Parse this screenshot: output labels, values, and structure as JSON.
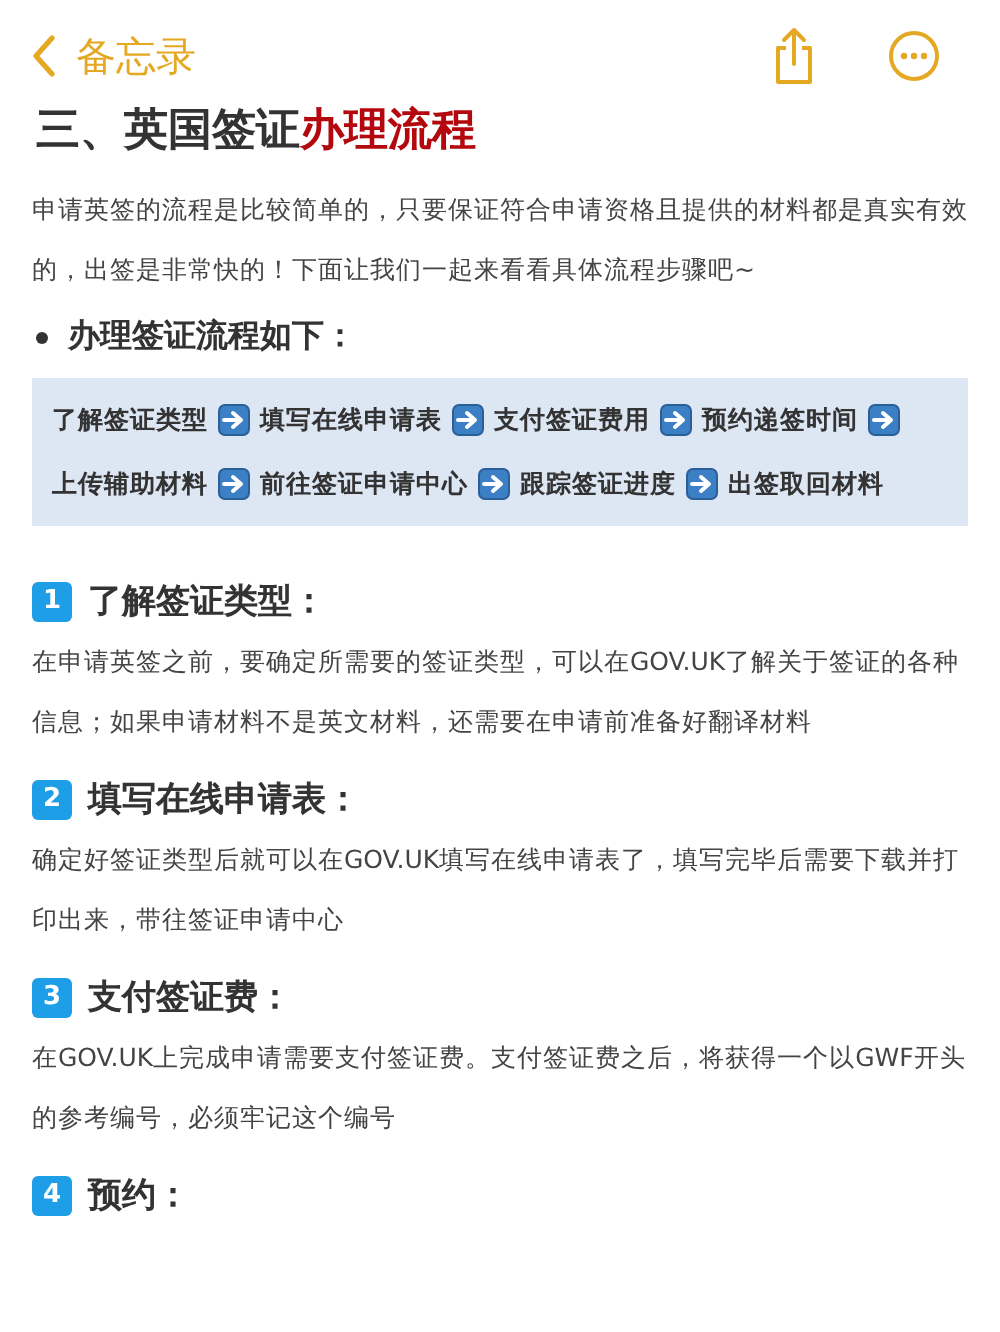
{
  "nav": {
    "back_label": "备忘录"
  },
  "heading": {
    "plain": "三、英国签证",
    "highlight": "办理流程"
  },
  "intro": "申请英签的流程是比较简单的，只要保证符合申请资格且提供的材料都是真实有效的，出签是非常快的！下面让我们一起来看看具体流程步骤吧~",
  "bullet": "办理签证流程如下：",
  "steps": [
    "了解签证类型",
    "填写在线申请表",
    "支付签证费用",
    "预约递签时间",
    "上传辅助材料",
    "前往签证申请中心",
    "跟踪签证进度",
    "出签取回材料"
  ],
  "sections": [
    {
      "number": "1",
      "title": "了解签证类型：",
      "body": "在申请英签之前，要确定所需要的签证类型，可以在GOV.UK了解关于签证的各种信息；如果申请材料不是英文材料，还需要在申请前准备好翻译材料"
    },
    {
      "number": "2",
      "title": "填写在线申请表：",
      "body": "确定好签证类型后就可以在GOV.UK填写在线申请表了，填写完毕后需要下载并打印出来，带往签证申请中心"
    },
    {
      "number": "3",
      "title": "支付签证费：",
      "body": "在GOV.UK上完成申请需要支付签证费。支付签证费之后，将获得一个以GWF开头的参考编号，必须牢记这个编号"
    },
    {
      "number": "4",
      "title": "预约："
    }
  ]
}
